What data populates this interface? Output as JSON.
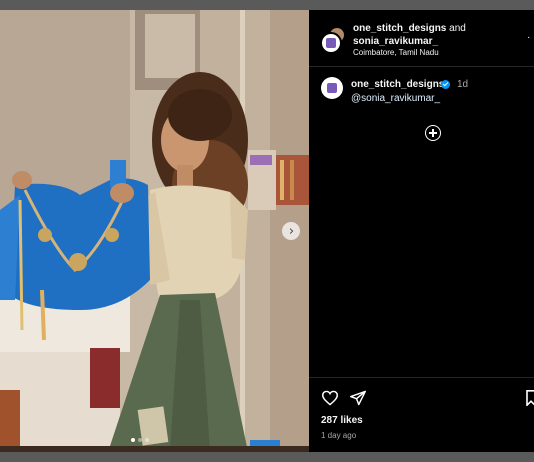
{
  "post": {
    "photo_alt": "Woman holding a blue embroidered blouse",
    "carousel_next_glyph": "›",
    "carousel_dots": 3
  },
  "header": {
    "user1": "one_stitch_designs",
    "and_text": "and",
    "user2": "sonia_ravikumar_",
    "location": "Coimbatore, Tamil Nadu",
    "more_glyph": "·"
  },
  "caption": {
    "username": "one_stitch_designs",
    "time": "1d",
    "mention": "@sonia_ravikumar_"
  },
  "footer": {
    "likes": "287 likes",
    "time_ago": "1 day ago"
  },
  "icons": [
    "heart-icon",
    "share-icon",
    "bookmark-icon",
    "add-icon",
    "verified-icon",
    "chevron-right-icon"
  ],
  "colors": {
    "verified": "#0095f6",
    "mention": "#e0f1ff",
    "panel_bg": "#000000",
    "divider": "#262626"
  }
}
